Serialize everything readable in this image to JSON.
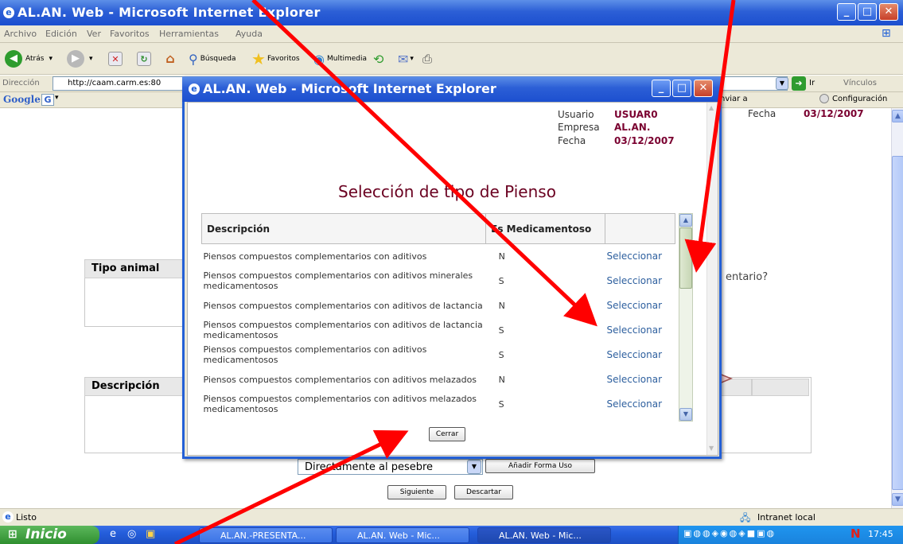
{
  "main_window": {
    "title": "AL.AN. Web - Microsoft Internet Explorer",
    "menu": [
      "Archivo",
      "Edición",
      "Ver",
      "Favoritos",
      "Herramientas",
      "Ayuda"
    ],
    "toolbar": {
      "back": "Atrás",
      "search": "Búsqueda",
      "favorites": "Favoritos",
      "multimedia": "Multimedia"
    },
    "address_label": "Dirección",
    "address_value": "http://caam.carm.es:80",
    "go_label": "Ir",
    "links_label": "Vínculos",
    "google_label": "Google",
    "enviar_label": "nviar a",
    "config_label": "Configuración",
    "status": "Listo",
    "zone": "Intranet local"
  },
  "background_page": {
    "fecha_label": "Fecha",
    "fecha_value": "03/12/2007",
    "tipo_animal_header": "Tipo animal",
    "question_fragment": "entario?",
    "descripcion_header": "Descripción",
    "forma_uso_value": "Directamente al pesebre",
    "add_forma_button": "Añadir Forma Uso",
    "next_button": "Siguiente",
    "discard_button": "Descartar"
  },
  "popup": {
    "title": "AL.AN. Web - Microsoft Internet Explorer",
    "usuario_label": "Usuario",
    "usuario_value": "USUAR0",
    "empresa_label": "Empresa",
    "empresa_value": "AL.AN.",
    "fecha_label": "Fecha",
    "fecha_value": "03/12/2007",
    "heading": "Selección de tipo de Pienso",
    "columns": [
      "Descripción",
      "Es Medicamentoso",
      ""
    ],
    "rows": [
      {
        "desc": "Piensos compuestos complementarios con aditivos",
        "es": "N",
        "action": "Seleccionar"
      },
      {
        "desc": "Piensos compuestos complementarios con aditivos minerales medicamentosos",
        "es": "S",
        "action": "Seleccionar"
      },
      {
        "desc": "Piensos compuestos complementarios con aditivos de lactancia",
        "es": "N",
        "action": "Seleccionar"
      },
      {
        "desc": "Piensos compuestos complementarios con aditivos de lactancia medicamentosos",
        "es": "S",
        "action": "Seleccionar"
      },
      {
        "desc": "Piensos compuestos complementarios con aditivos medicamentosos",
        "es": "S",
        "action": "Seleccionar"
      },
      {
        "desc": "Piensos compuestos complementarios con aditivos melazados",
        "es": "N",
        "action": "Seleccionar"
      },
      {
        "desc": "Piensos compuestos complementarios con aditivos melazados medicamentosos",
        "es": "S",
        "action": "Seleccionar"
      }
    ],
    "close_button": "Cerrar"
  },
  "taskbar": {
    "start": "Inicio",
    "tasks": [
      "AL.AN.-PRESENTA...",
      "AL.AN. Web - Mic...",
      "AL.AN. Web - Mic..."
    ],
    "clock": "17:45"
  },
  "colors": {
    "xp_blue": "#245edb",
    "accent_wine": "#7a0030",
    "annotation_red": "#ff0000"
  }
}
